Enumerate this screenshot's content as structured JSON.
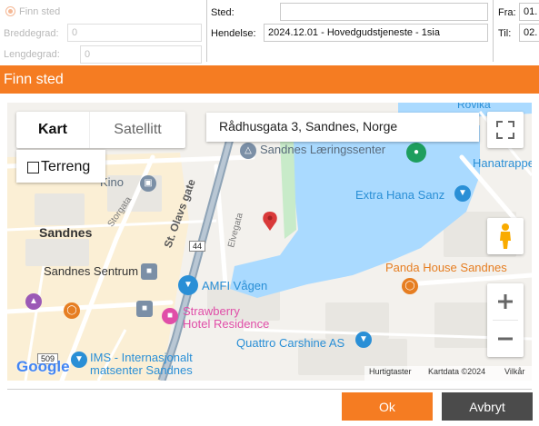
{
  "form": {
    "finn_sted": "Finn sted",
    "breddegrad_label": "Breddegrad:",
    "breddegrad_value": "0",
    "lengdegrad_label": "Lengdegrad:",
    "lengdegrad_value": "0",
    "sted_label": "Sted:",
    "sted_value": "",
    "hendelse_label": "Hendelse:",
    "hendelse_value": "2024.12.01 - Hovedgudstjeneste - 1sia",
    "fra_label": "Fra:",
    "fra_value": "01.",
    "til_label": "Til:",
    "til_value": "02."
  },
  "dialog": {
    "title": "Finn sted"
  },
  "map": {
    "tab_map": "Kart",
    "tab_satellite": "Satellitt",
    "terrain_label": "Terreng",
    "address": "Rådhusgata 3, Sandnes, Norge",
    "labels": {
      "rovika": "Rovika",
      "laeringssenter": "Sandnes Læringssenter",
      "hanatrappe": "Hanatrappe",
      "kino": "Kino",
      "extra": "Extra Hana Sanz",
      "storgata": "Storgata",
      "st_olavs": "St. Olavs gate",
      "elvegata": "Elvegata",
      "sandnes": "Sandnes",
      "road44": "44",
      "sentrum": "Sandnes Sentrum",
      "amfi": "AMFI Vågen",
      "panda": "Panda House Sandnes",
      "strawberry1": "Strawberry",
      "strawberry2": "Hotel Residence",
      "quattro": "Quattro Carshine AS",
      "ims1": "IMS - Internasjonalt",
      "ims2": "matsenter Sandnes",
      "road509": "509",
      "google": "Google",
      "shortcuts": "Hurtigtaster",
      "mapdata": "Kartdata ©2024",
      "terms": "Vilkår"
    }
  },
  "buttons": {
    "ok": "Ok",
    "cancel": "Avbryt"
  },
  "colors": {
    "accent": "#f57c22",
    "water": "#aadaff",
    "cancel": "#4b4b4b"
  }
}
